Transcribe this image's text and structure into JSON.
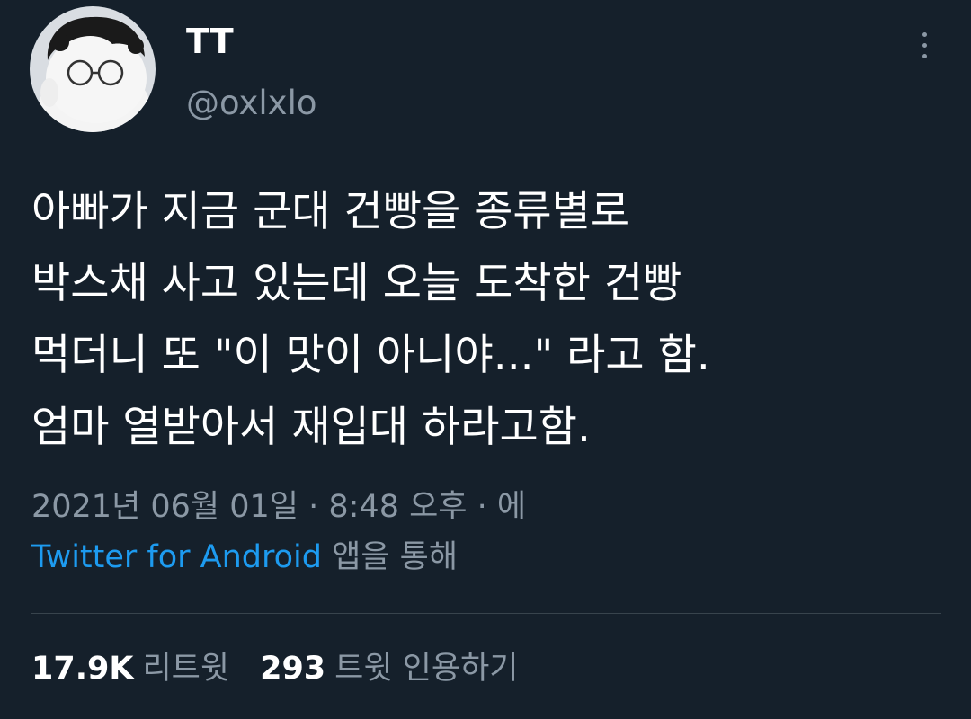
{
  "author": {
    "display_name": "TT",
    "handle": "@oxlxlo",
    "avatar_icon": "avatar-cartoon-glasses"
  },
  "menu": {
    "icon": "more-vertical-icon"
  },
  "tweet": {
    "lines": [
      "아빠가 지금 군대 건빵을 종류별로",
      "박스채 사고 있는데 오늘 도착한 건빵",
      "먹더니 또 \"이 맛이 아니야...\" 라고 함.",
      "엄마 열받아서 재입대 하라고함."
    ]
  },
  "meta": {
    "datetime": "2021년 06월 01일 · 8:48 오후 · 에",
    "source_link": "Twitter for Android",
    "source_suffix": " 앱을 통해"
  },
  "stats": {
    "retweets_count": "17.9K",
    "retweets_label": "리트윗",
    "quotes_count": "293",
    "quotes_label": "트윗 인용하기"
  },
  "colors": {
    "background": "#15202b",
    "text_primary": "#ffffff",
    "text_secondary": "#8b98a5",
    "link": "#1d9bf0",
    "divider": "#38444d"
  }
}
